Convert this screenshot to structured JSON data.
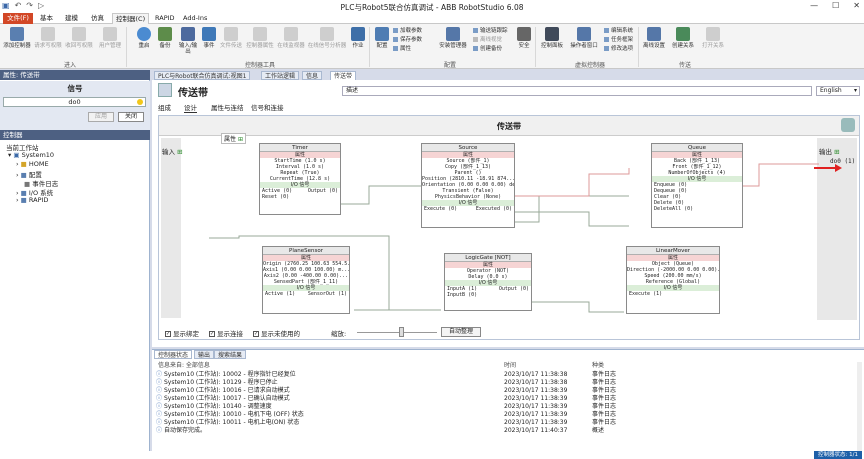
{
  "app": {
    "title": "PLC与Robot5联合仿真调试 - ABB RobotStudio 6.08"
  },
  "ribbon": {
    "tabs": [
      "文件(F)",
      "基本",
      "建模",
      "仿真",
      "控制器(C)",
      "RAPID",
      "Add-Ins"
    ],
    "buttons": [
      "添加控制器",
      "请求写权限",
      "收回写权限",
      "用户管理",
      "重启",
      "备份",
      "输入/输出",
      "事件",
      "文件传送",
      "控制器属性",
      "在线监视器",
      "在线信号分析器",
      "作业",
      "配置",
      "安装管理器",
      "安全",
      "控制面板",
      "操作者窗口",
      "任务框架",
      "离线设置",
      "创建关系",
      "打开关系"
    ],
    "small_buttons": [
      "加载参数",
      "保存参数",
      "属性",
      "编辑系统",
      "任务框架",
      "修改选项",
      "输送链跟踪",
      "离线视觉",
      "创建备份"
    ],
    "groups": [
      "进入",
      "控制器工具",
      "配置",
      "虚拟控制器",
      "传送"
    ]
  },
  "left_panel": {
    "props_title": "属性: 传送带",
    "signal_title": "信号",
    "signal_name": "do0",
    "apply_btn": "应用",
    "close_btn": "关闭",
    "controller_title": "控制器",
    "station_label": "当前工作站",
    "tree": [
      "System10",
      "HOME",
      "配置",
      "事件日志",
      "I/O 系统",
      "RAPID"
    ]
  },
  "doc_tabs": [
    "PLC与Robot联合仿真调试:视图1",
    "工作站逻辑",
    "信息",
    "传送带"
  ],
  "editor": {
    "title": "传送带",
    "desc": "描述",
    "language": "English",
    "subtabs": [
      "组成",
      "设计",
      "属性与连结",
      "信号和连接"
    ],
    "canvas_title": "传送带",
    "props_label": "属性",
    "input_label": "输入",
    "output_label": "输出",
    "output_signal": "do0 (1)",
    "show_binding": "显示绑定",
    "show_connect": "显示连接",
    "show_unused": "显示未使用的",
    "zoom": "缩放:",
    "auto_arrange": "自动整理"
  },
  "blocks": {
    "timer": {
      "name": "Timer",
      "sec": "属性",
      "props": [
        "StartTime (1.0 s)",
        "Interval (1.0 s)",
        "Repeat (True)",
        "CurrentTime (12.8 s)"
      ],
      "sig": "I/O 信号",
      "ins": [
        "Active (0)",
        "Reset (0)"
      ],
      "outs": [
        "Output (0)"
      ]
    },
    "source": {
      "name": "Source",
      "sec": "属性",
      "props": [
        "Source (部件_1)",
        "Copy (部件_1_13)",
        "Parent ()",
        "Position (2810.11 -18.91 874...)",
        "Orientation (0.00 0.00 0.00) deg",
        "Transient (False)",
        "PhysicsBehavior (None)"
      ],
      "sig": "I/O 信号",
      "ins": [
        "Execute (0)"
      ],
      "outs": [
        "Executed (0)"
      ]
    },
    "queue": {
      "name": "Queue",
      "sec": "属性",
      "props": [
        "Back (部件_1_13)",
        "Front (部件_1_12)",
        "NumberOfObjects (4)"
      ],
      "sig": "I/O 信号",
      "ins": [
        "Enqueue (0)",
        "Dequeue (0)",
        "Clear (0)",
        "Delete (0)",
        "DeleteAll (0)"
      ],
      "outs": []
    },
    "sensor": {
      "name": "PlaneSensor",
      "sec": "属性",
      "props": [
        "Origin (2760.25 100.63 554.5...)",
        "Axis1 (0.00 0.00 100.00) m...",
        "Axis2 (0.00 -400.00 0.00)...",
        "SensedPart (部件_1_11)"
      ],
      "sig": "I/O 信号",
      "ins": [
        "Active (1)"
      ],
      "outs": [
        "SensorOut (1)"
      ]
    },
    "logic": {
      "name": "LogicGate [NOT]",
      "sec": "属性",
      "props": [
        "Operator (NOT)",
        "Delay (0.0 s)"
      ],
      "sig": "I/O 信号",
      "ins": [
        "InputA (1)",
        "InputB (0)"
      ],
      "outs": [
        "Output (0)"
      ]
    },
    "mover": {
      "name": "LinearMover",
      "sec": "属性",
      "props": [
        "Object (Queue)",
        "Direction (-2000.00 0.00 0.00)...",
        "Speed (200.00 mm/s)",
        "Reference (Global)"
      ],
      "sig": "I/O 信号",
      "ins": [
        "Execute (1)"
      ],
      "outs": []
    }
  },
  "bottom": {
    "tabs": [
      "控制器状态",
      "输出",
      "搜索结果"
    ],
    "header": {
      "info": "信息来自: 全部信息",
      "time": "时间",
      "category": "种类"
    },
    "rows": [
      {
        "msg": "System10 (工作站): 10002 - 程序指针已经复位",
        "time": "2023/10/17 11:38:38",
        "cat": "事件日志"
      },
      {
        "msg": "System10 (工作站): 10129 - 程序已停止",
        "time": "2023/10/17 11:38:38",
        "cat": "事件日志"
      },
      {
        "msg": "System10 (工作站): 10016 - 已请求自动模式",
        "time": "2023/10/17 11:38:39",
        "cat": "事件日志"
      },
      {
        "msg": "System10 (工作站): 10017 - 已确认自动模式",
        "time": "2023/10/17 11:38:39",
        "cat": "事件日志"
      },
      {
        "msg": "System10 (工作站): 10140 - 调整速度",
        "time": "2023/10/17 11:38:39",
        "cat": "事件日志"
      },
      {
        "msg": "System10 (工作站): 10010 - 电机下电 (OFF) 状态",
        "time": "2023/10/17 11:38:39",
        "cat": "事件日志"
      },
      {
        "msg": "System10 (工作站): 10011 - 电机上电(ON) 状态",
        "time": "2023/10/17 11:38:39",
        "cat": "事件日志"
      },
      {
        "msg": "自动保存完成。",
        "time": "2023/10/17 11:40:37",
        "cat": "概述"
      }
    ]
  },
  "status": {
    "controller": "控制器状态: 1/1"
  }
}
